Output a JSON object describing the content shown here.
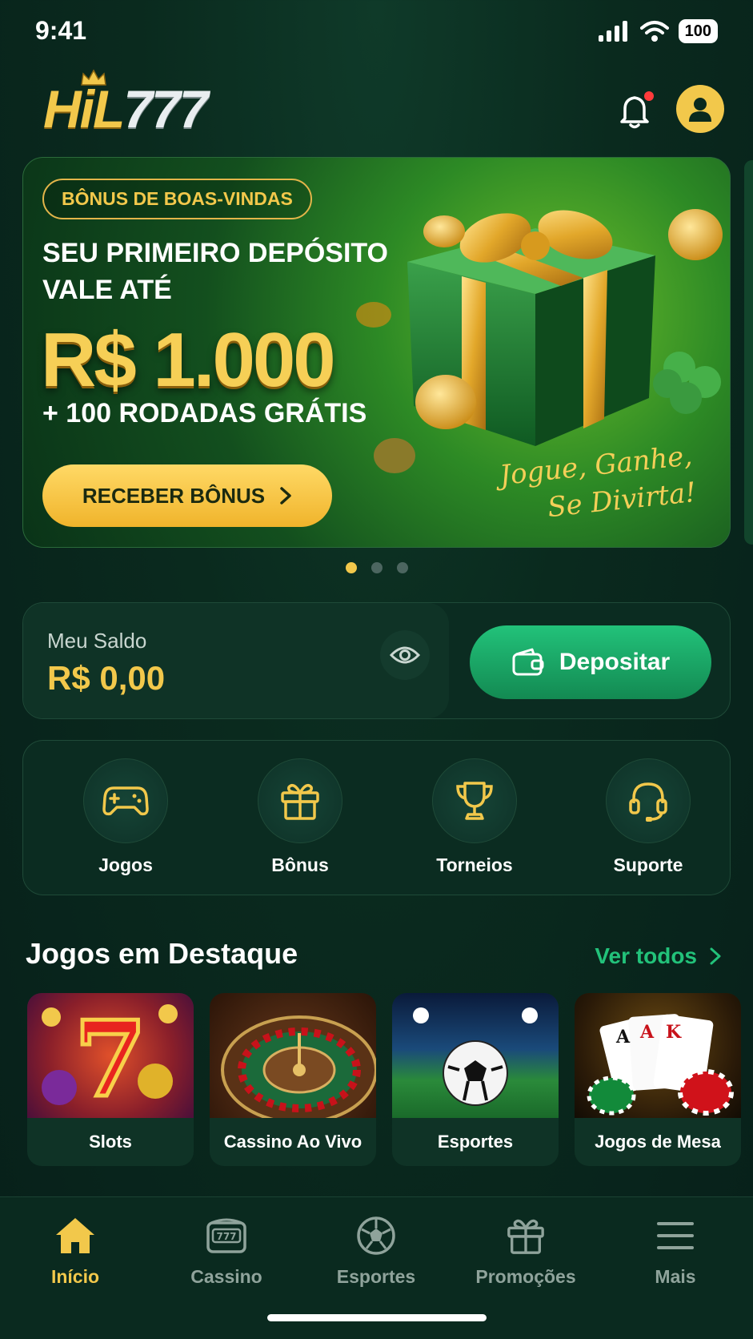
{
  "status": {
    "time": "9:41",
    "battery": "100"
  },
  "header": {
    "logo_part1": "HiL",
    "logo_part2": "777"
  },
  "banner": {
    "badge": "BÔNUS DE BOAS-VINDAS",
    "headline": "SEU PRIMEIRO DEPÓSITO VALE ATÉ",
    "amount": "R$ 1.000",
    "spins": "+ 100 RODADAS GRÁTIS",
    "cta_label": "RECEBER BÔNUS",
    "tagline": "Jogue, Ganhe, Se Divirta!",
    "slides_total": 3,
    "active_slide": 1
  },
  "balance": {
    "label": "Meu Saldo",
    "value": "R$ 0,00",
    "deposit_label": "Depositar"
  },
  "quick_actions": [
    {
      "label": "Jogos",
      "icon": "gamepad-icon"
    },
    {
      "label": "Bônus",
      "icon": "gift-icon"
    },
    {
      "label": "Torneios",
      "icon": "trophy-icon"
    },
    {
      "label": "Suporte",
      "icon": "headset-icon"
    }
  ],
  "featured": {
    "title": "Jogos em Destaque",
    "see_all": "Ver todos",
    "games": [
      {
        "label": "Slots",
        "art": "slots-seven"
      },
      {
        "label": "Cassino Ao Vivo",
        "art": "roulette-wheel"
      },
      {
        "label": "Esportes",
        "art": "soccer-ball-stadium"
      },
      {
        "label": "Jogos de Mesa",
        "art": "cards-and-chips"
      }
    ]
  },
  "bottom_nav": {
    "active": "Início",
    "items": [
      {
        "label": "Início",
        "icon": "home-icon"
      },
      {
        "label": "Cassino",
        "icon": "slot-machine-icon"
      },
      {
        "label": "Esportes",
        "icon": "soccer-ball-icon"
      },
      {
        "label": "Promoções",
        "icon": "gift-icon"
      },
      {
        "label": "Mais",
        "icon": "menu-icon"
      }
    ]
  },
  "colors": {
    "accent_gold": "#f2c84b",
    "accent_green": "#22c27a",
    "background": "#0a2a1e"
  }
}
